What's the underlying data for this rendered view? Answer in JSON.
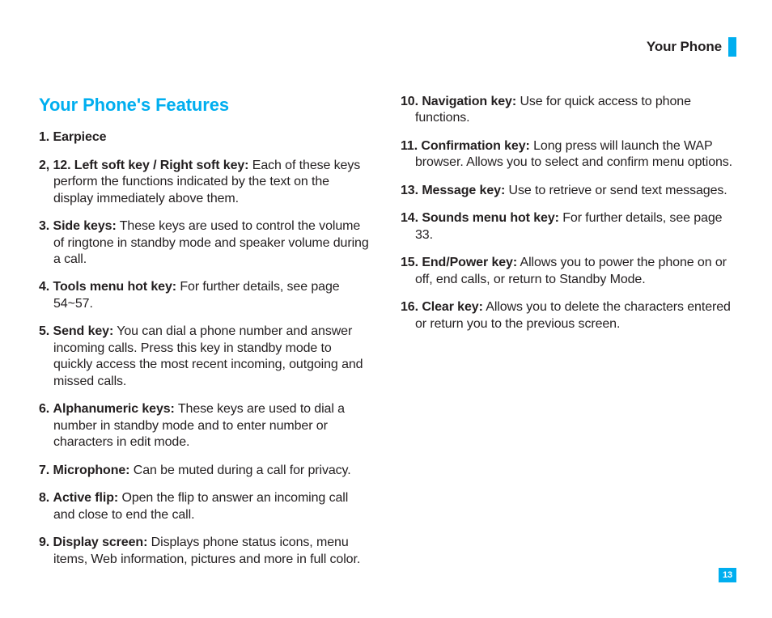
{
  "header": {
    "section": "Your Phone"
  },
  "title": "Your Phone's Features",
  "page_number": "13",
  "features": [
    {
      "num": "1.",
      "name": "Earpiece",
      "desc": ""
    },
    {
      "num": "2, 12.",
      "name": "Left soft key / Right soft key:",
      "desc": "Each of these keys perform the functions indicated by the text on the display immediately above them."
    },
    {
      "num": "3.",
      "name": "Side keys:",
      "desc": "These keys are used to control the volume of ringtone in standby mode and speaker volume during a call."
    },
    {
      "num": "4.",
      "name": "Tools menu hot key:",
      "desc": "For further details, see page 54~57."
    },
    {
      "num": "5.",
      "name": "Send key:",
      "desc": "You can dial a phone number and answer incoming calls. Press this key in standby mode to quickly access the most recent incoming, outgoing and missed calls."
    },
    {
      "num": "6.",
      "name": "Alphanumeric keys:",
      "desc": "These keys are used to dial a number in standby mode and to enter number or characters in edit mode."
    },
    {
      "num": "7.",
      "name": "Microphone:",
      "desc": "Can be muted during a call for privacy."
    },
    {
      "num": "8.",
      "name": "Active flip:",
      "desc": "Open the flip to answer an incoming call and close to end the call."
    },
    {
      "num": "9.",
      "name": "Display screen:",
      "desc": "Displays phone status icons, menu items, Web information, pictures and more in full color."
    },
    {
      "num": "10.",
      "name": "Navigation key:",
      "desc": "Use for quick access to phone functions."
    },
    {
      "num": "11.",
      "name": "Confirmation key:",
      "desc": "Long press will launch the WAP browser. Allows you to select and confirm menu options."
    },
    {
      "num": "13.",
      "name": "Message key:",
      "desc": "Use to retrieve or send text messages."
    },
    {
      "num": "14.",
      "name": "Sounds menu hot key:",
      "desc": "For further details, see page 33."
    },
    {
      "num": "15.",
      "name": "End/Power key:",
      "desc": "Allows you to power the phone on or off, end calls, or return to Standby Mode."
    },
    {
      "num": "16.",
      "name": "Clear key:",
      "desc": "Allows you to delete the characters entered or return you to the previous screen."
    }
  ]
}
